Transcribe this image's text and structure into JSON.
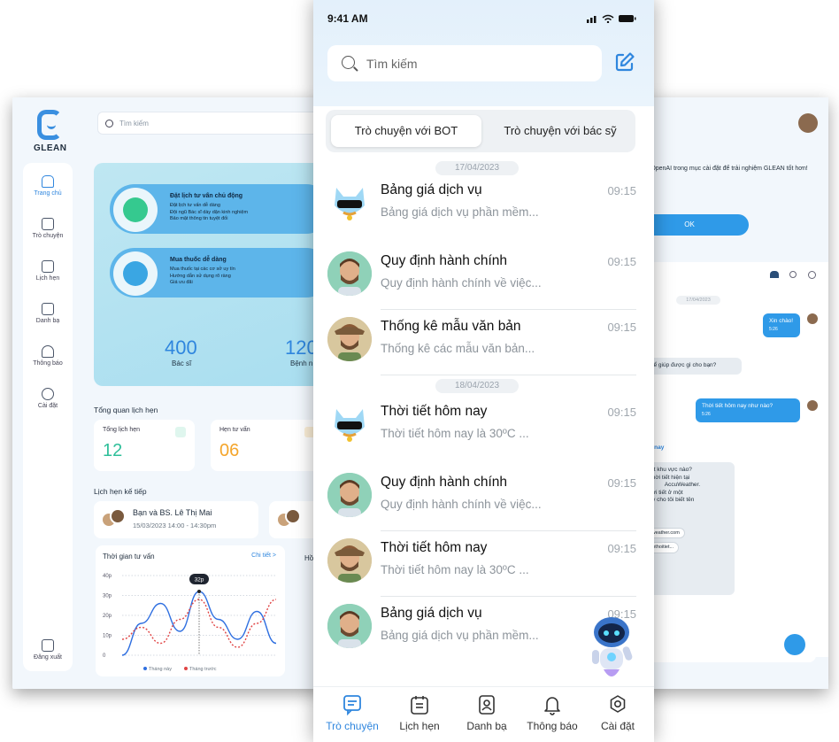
{
  "dashboard": {
    "brand": "GLEAN",
    "search_placeholder": "Tìm kiếm",
    "nav": [
      {
        "label": "Trang chủ",
        "icon": "home-icon"
      },
      {
        "label": "Trò chuyện",
        "icon": "chat-icon"
      },
      {
        "label": "Lịch hẹn",
        "icon": "calendar-icon"
      },
      {
        "label": "Danh bạ",
        "icon": "contacts-icon"
      },
      {
        "label": "Thông báo",
        "icon": "bell-icon"
      },
      {
        "label": "Cài đặt",
        "icon": "gear-icon"
      }
    ],
    "logout": "Đăng xuất",
    "features": [
      {
        "title": "Đặt lịch tư vấn chủ động",
        "lines": [
          "Đặt lịch tư vấn dễ dàng",
          "Đội ngũ Bác sĩ dày dặn kinh nghiệm",
          "Bảo mật thông tin tuyệt đối"
        ]
      },
      {
        "title": "Mua thuốc dễ dàng",
        "lines": [
          "Mua thuốc tại các cơ sở uy tín",
          "Hướng dẫn sử dụng rõ ràng",
          "Giá ưu đãi"
        ]
      }
    ],
    "stats": [
      {
        "value": "400",
        "label": "Bác sĩ"
      },
      {
        "value": "120",
        "label": "Bệnh n"
      }
    ],
    "overview_title": "Tổng quan lịch hẹn",
    "overview_cards": [
      {
        "label": "Tổng lịch hẹn",
        "value": "12",
        "color": "#2fbf9a"
      },
      {
        "label": "Hẹn tư vấn",
        "value": "06",
        "color": "#f4a52b"
      }
    ],
    "next_title": "Lịch hẹn kế tiếp",
    "next_appt": {
      "who": "Bạn và BS. Lê Thị Mai",
      "when": "15/03/2023  14:00 - 14:30pm"
    },
    "chart_title": "Thời gian tư vấn",
    "chart_link": "Chi tiết >",
    "chart_tooltip": "32p",
    "chart_side_label": "Hồ",
    "chart_data": {
      "type": "line",
      "y_ticks": [
        "40p",
        "30p",
        "20p",
        "10p",
        "0"
      ],
      "ylim": [
        0,
        40
      ],
      "x": [
        0,
        1,
        2,
        3,
        4,
        5,
        6,
        7,
        8
      ],
      "series": [
        {
          "name": "Tháng này",
          "color": "#2f6fe0",
          "values": [
            0,
            16,
            26,
            12,
            32,
            18,
            8,
            22,
            6
          ]
        },
        {
          "name": "Tháng trước",
          "color": "#e04545",
          "values": [
            8,
            14,
            6,
            18,
            28,
            14,
            4,
            16,
            28
          ]
        }
      ]
    }
  },
  "chat_window": {
    "notice": "OpenAI trong mục cài đặt để trải nghiệm GLEAN tốt hơn!",
    "ok": "OK",
    "date": "17/04/2023",
    "messages": [
      {
        "text": "Xin chào!",
        "time": "5:26",
        "from": "me"
      },
      {
        "text": "h có thể giúp được gì cho bạn?",
        "from": "bot"
      },
      {
        "text": "Thời tiết hôm nay như nào?",
        "time": "5:26",
        "from": "me"
      }
    ],
    "bot_heading": "ết hôm nay",
    "bot_lines": [
      "thời tiết khu vực nào?",
      "o dõi thời tiết hiện tại",
      "AccuWeather.",
      "biết thời tiết ở một",
      "hể, hãy cho tôi biết tên"
    ],
    "links": [
      "accuweather.com",
      "dubaothoitiet..."
    ]
  },
  "phone": {
    "status_time": "9:41 AM",
    "search_placeholder": "Tìm kiếm",
    "tabs": [
      "Trò chuyện với BOT",
      "Trò chuyện với bác sỹ"
    ],
    "dates": [
      "17/04/2023",
      "18/04/2023"
    ],
    "chats": [
      {
        "name": "Bảng giá dịch vụ",
        "time": "09:15",
        "preview": "Bảng giá dịch vụ phần mềm...",
        "avatar": "bot"
      },
      {
        "name": "Quy định hành chính",
        "time": "09:15",
        "preview": "Quy định hành chính về việc...",
        "avatar": "man1"
      },
      {
        "name": "Thống kê mẫu văn bản",
        "time": "09:15",
        "preview": "Thống kê các mẫu văn bản...",
        "avatar": "man2"
      },
      {
        "name": "Thời tiết hôm nay",
        "time": "09:15",
        "preview": "Thời tiết hôm nay là 30ºC ...",
        "avatar": "bot"
      },
      {
        "name": "Quy định hành chính",
        "time": "09:15",
        "preview": "Quy định hành chính về việc...",
        "avatar": "man1"
      },
      {
        "name": "Thời tiết hôm nay",
        "time": "09:15",
        "preview": "Thời tiết hôm nay là 30ºC ...",
        "avatar": "man2"
      },
      {
        "name": "Bảng giá dịch vụ",
        "time": "09:15",
        "preview": "Bảng giá dịch vụ phần mềm...",
        "avatar": "man1"
      }
    ],
    "bottom_nav": [
      {
        "label": "Trò chuyện",
        "icon": "chat-icon"
      },
      {
        "label": "Lịch hẹn",
        "icon": "calendar-icon"
      },
      {
        "label": "Danh bạ",
        "icon": "contacts-icon"
      },
      {
        "label": "Thông báo",
        "icon": "bell-icon"
      },
      {
        "label": "Cài đặt",
        "icon": "gear-icon"
      }
    ],
    "accent": "#2f86de"
  }
}
